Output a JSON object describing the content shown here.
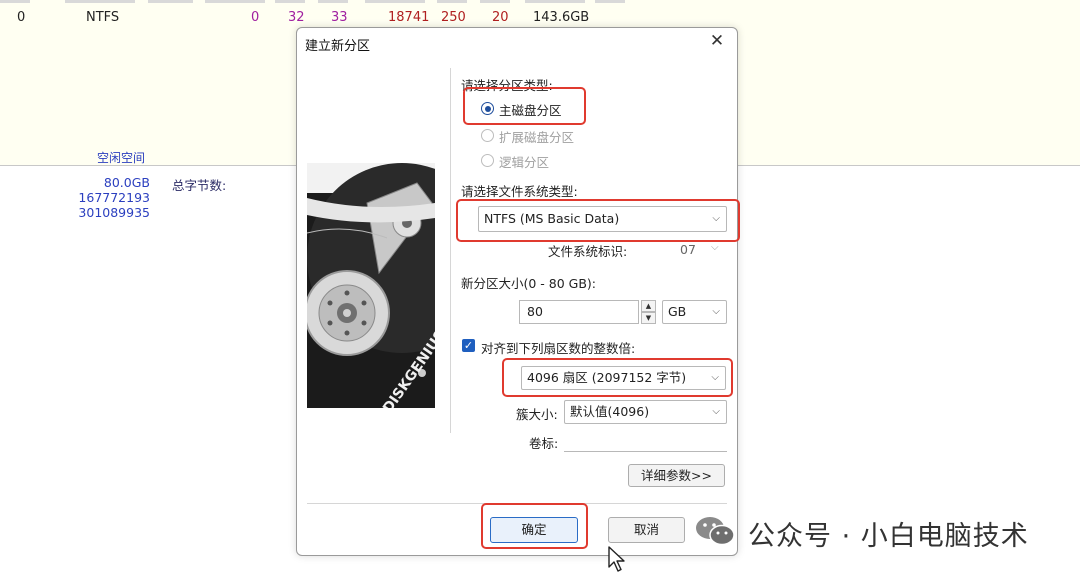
{
  "background": {
    "row": [
      "0",
      "NTFS",
      "0",
      "32",
      "33",
      "18741",
      "250",
      "20",
      "143.6GB"
    ],
    "free_space_label": "空闲空间",
    "free_values": [
      "80.0GB",
      "167772193",
      "301089935"
    ],
    "total_bytes_label": "总字节数:"
  },
  "dialog": {
    "title": "建立新分区",
    "close_label": "✕",
    "image_text": "DISKGENIUS",
    "partition_type_label": "请选择分区类型:",
    "partition_types": [
      "主磁盘分区",
      "扩展磁盘分区",
      "逻辑分区"
    ],
    "fs_type_label": "请选择文件系统类型:",
    "fs_type_value": "NTFS (MS Basic Data)",
    "fs_id_label": "文件系统标识:",
    "fs_id_value": "07",
    "size_label": "新分区大小(0 - 80 GB):",
    "size_value": "80",
    "size_unit": "GB",
    "align_label": "对齐到下列扇区数的整数倍:",
    "align_value": "4096 扇区 (2097152 字节)",
    "cluster_label": "簇大小:",
    "cluster_value": "默认值(4096)",
    "volume_label": "卷标:",
    "volume_value": "",
    "detail_button": "详细参数>>",
    "ok_button": "确定",
    "cancel_button": "取消"
  },
  "watermark": "公众号 · 小白电脑技术",
  "colors": {
    "highlight": "#e03a2f",
    "accent": "#1f4e9c",
    "blue_text": "#2b3fbf"
  }
}
